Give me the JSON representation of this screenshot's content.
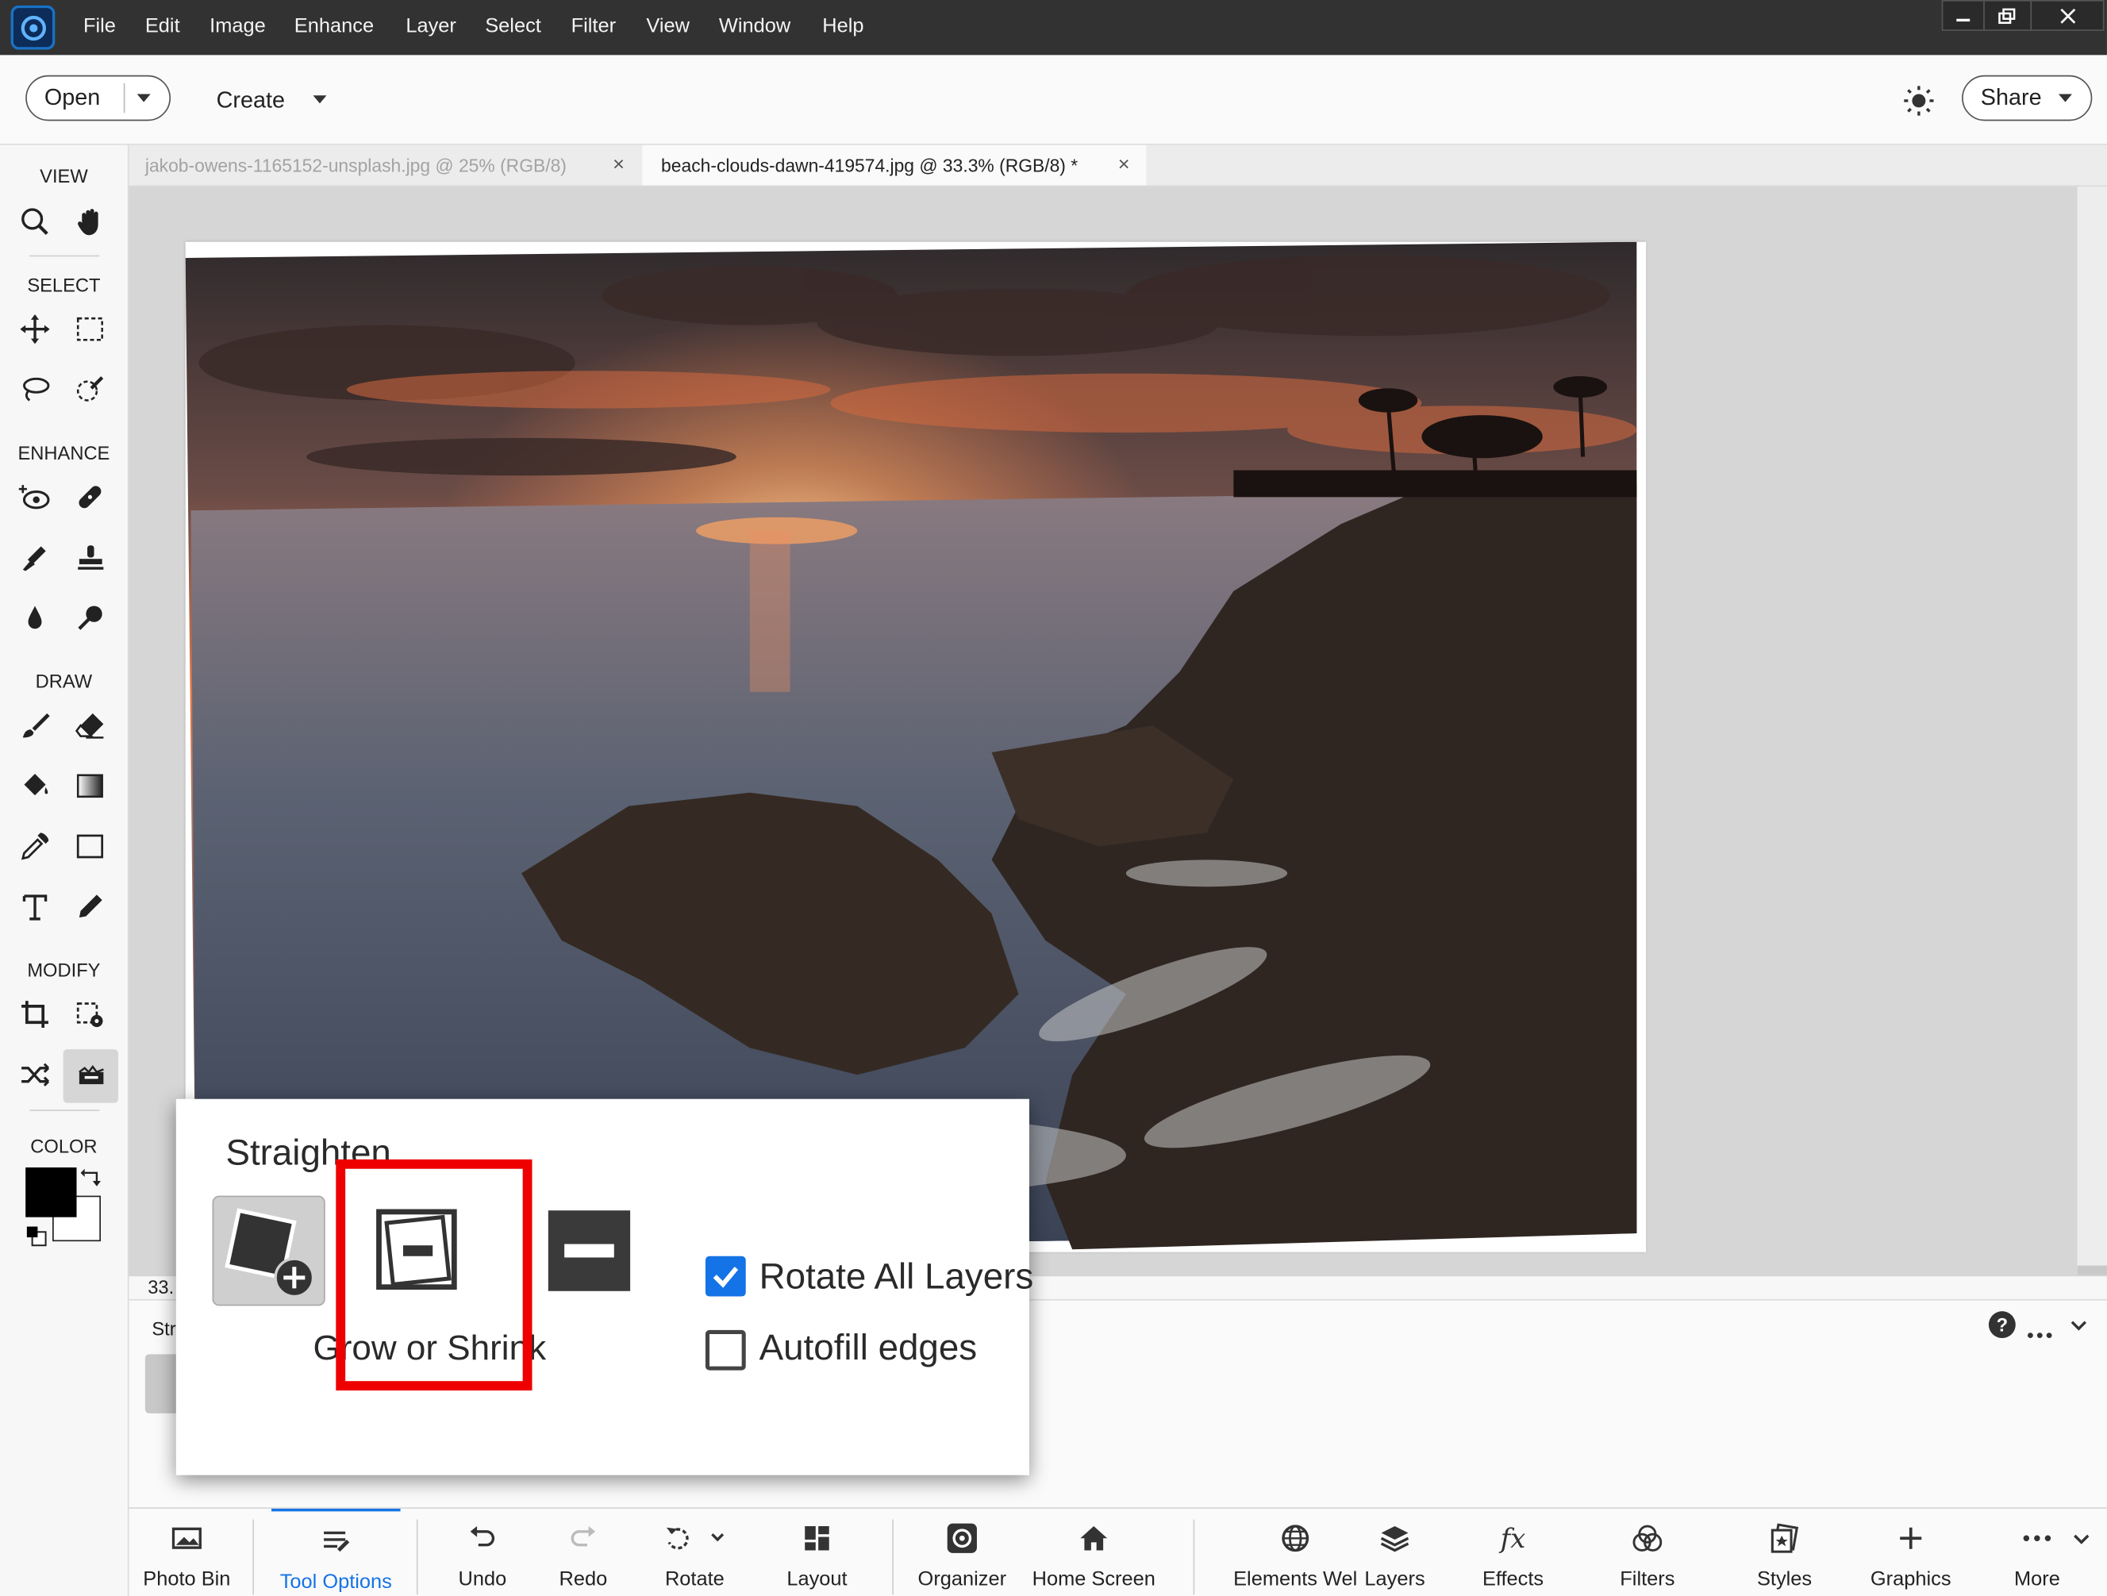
{
  "menubar": {
    "items": [
      "File",
      "Edit",
      "Image",
      "Enhance",
      "Layer",
      "Select",
      "Filter",
      "View",
      "Window",
      "Help"
    ],
    "window_controls": {
      "minimize": "minimize-icon",
      "restore": "restore-icon",
      "close": "close-icon"
    }
  },
  "topbar": {
    "open_label": "Open",
    "create_label": "Create",
    "share_label": "Share",
    "brightness_icon": "sun-icon"
  },
  "toolbox": {
    "view_heading": "VIEW",
    "select_heading": "SELECT",
    "enhance_heading": "ENHANCE",
    "draw_heading": "DRAW",
    "modify_heading": "MODIFY",
    "color_heading": "COLOR",
    "foreground_color": "#000000",
    "background_color": "#ffffff"
  },
  "tabs": [
    {
      "title": "jakob-owens-1165152-unsplash.jpg @ 25% (RGB/8)",
      "close": "×",
      "active": false
    },
    {
      "title": "beach-clouds-dawn-419574.jpg @ 33.3% (RGB/8) *",
      "close": "×",
      "active": true
    }
  ],
  "statusbar": {
    "zoom_partial": "33."
  },
  "options_region": {
    "label_partial": "Str"
  },
  "popup": {
    "title": "Straighten",
    "mode_label": "Grow or Shrink",
    "rotate_all_layers": {
      "label": "Rotate All Layers",
      "checked": true
    },
    "autofill_edges": {
      "label": "Autofill edges",
      "checked": false
    },
    "highlight_color": "#ee0000"
  },
  "bottombar": {
    "items": [
      {
        "label": "Photo Bin",
        "icon": "photo-bin-icon"
      },
      {
        "label": "Tool Options",
        "icon": "tool-options-icon"
      },
      {
        "label": "Undo",
        "icon": "undo-icon"
      },
      {
        "label": "Redo",
        "icon": "redo-icon"
      },
      {
        "label": "Rotate",
        "icon": "rotate-icon"
      },
      {
        "label": "Layout",
        "icon": "layout-icon"
      },
      {
        "label": "Organizer",
        "icon": "organizer-icon"
      },
      {
        "label": "Home Screen",
        "icon": "home-icon"
      },
      {
        "label": "Elements Wel",
        "icon": "globe-icon"
      },
      {
        "label": "Layers",
        "icon": "layers-icon"
      },
      {
        "label": "Effects",
        "icon": "fx-icon"
      },
      {
        "label": "Filters",
        "icon": "filters-icon"
      },
      {
        "label": "Styles",
        "icon": "styles-icon"
      },
      {
        "label": "Graphics",
        "icon": "plus-icon"
      },
      {
        "label": "More",
        "icon": "more-icon"
      }
    ],
    "active": "Tool Options",
    "accent_color": "#1473e6"
  }
}
